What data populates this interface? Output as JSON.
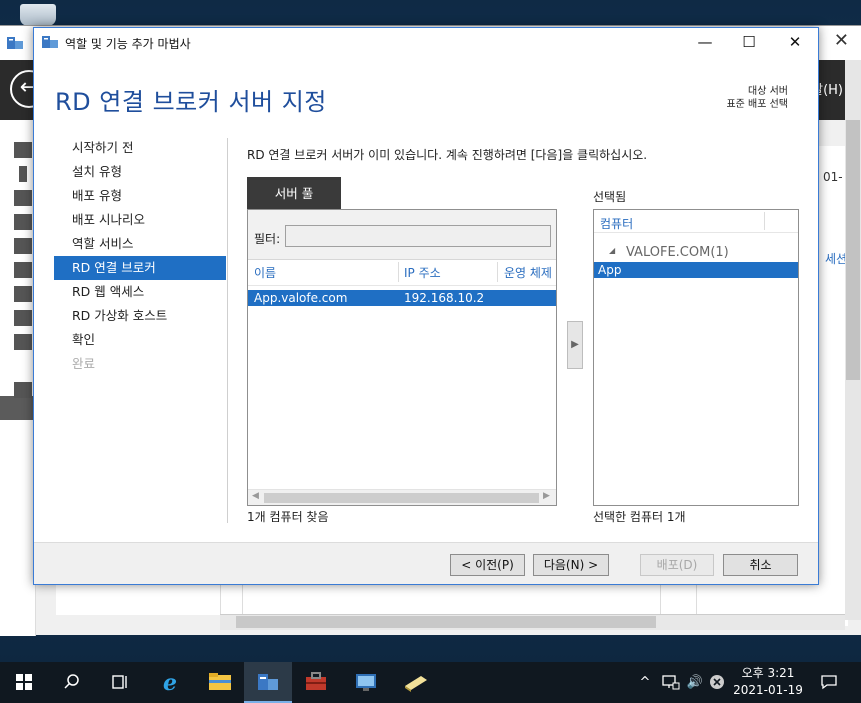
{
  "dialog": {
    "title": "역할 및 기능 추가 마법사",
    "heading": "RD 연결 브로커 서버 지정",
    "destination_label": "대상 서버",
    "destination_value": "표준 배포 선택",
    "window_controls": {
      "minimize": "—",
      "maximize": "☐",
      "close": "✕"
    }
  },
  "nav": {
    "items": [
      {
        "label": "시작하기 전",
        "state": "normal"
      },
      {
        "label": "설치 유형",
        "state": "normal"
      },
      {
        "label": "배포 유형",
        "state": "normal"
      },
      {
        "label": "배포 시나리오",
        "state": "normal"
      },
      {
        "label": "역할 서비스",
        "state": "normal"
      },
      {
        "label": "RD 연결 브로커",
        "state": "active"
      },
      {
        "label": "RD 웹 액세스",
        "state": "normal"
      },
      {
        "label": "RD 가상화 호스트",
        "state": "normal"
      },
      {
        "label": "확인",
        "state": "normal"
      },
      {
        "label": "완료",
        "state": "disabled"
      }
    ]
  },
  "main": {
    "instruction": "RD 연결 브로커 서버가 이미 있습니다. 계속 진행하려면 [다음]을 클릭하십시오.",
    "server_pool_tab": "서버 풀",
    "filter_label": "필터:",
    "filter_value": "",
    "columns": [
      "이름",
      "IP 주소",
      "운영 체제"
    ],
    "rows": [
      {
        "name": "App.valofe.com",
        "ip": "192.168.10.2",
        "os": ""
      }
    ],
    "found_count": "1개 컴퓨터 찾음",
    "add_arrow": "▶",
    "selected_title": "선택됨",
    "selected_column": "컴퓨터",
    "selected_group": "VALOFE.COM(1)",
    "selected_items": [
      "App"
    ],
    "selected_count": "선택한 컴퓨터 1개"
  },
  "footer": {
    "prev": "< 이전(P)",
    "next": "다음(N) >",
    "deploy": "배포(D)",
    "cancel": "취소"
  },
  "background": {
    "help_menu": "말(H)",
    "side_text_1": "01-",
    "side_text_2": "세션"
  },
  "taskbar": {
    "time": "오후 3:21",
    "date": "2021-01-19",
    "tray_up": "^",
    "volume": "🔊"
  },
  "colors": {
    "accent": "#1f6fc4",
    "heading": "#1f4e9c",
    "link": "#2a6dbf"
  }
}
